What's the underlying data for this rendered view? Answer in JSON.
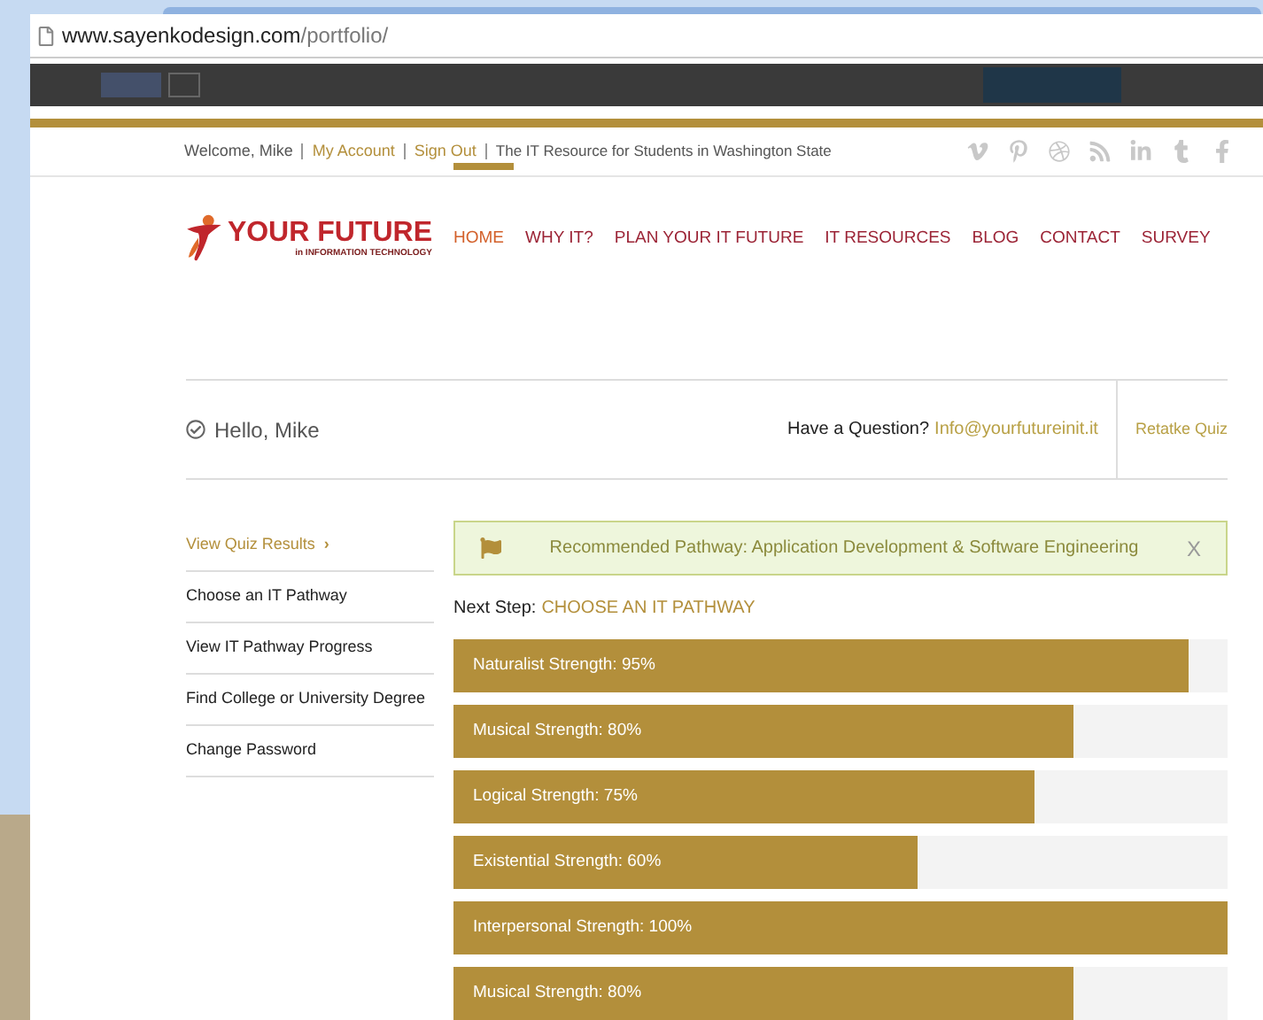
{
  "browser": {
    "url_host": "www.sayenkodesign.com",
    "url_path": "/portfolio/"
  },
  "top_bar": {
    "welcome": "Welcome, Mike",
    "links": [
      {
        "label": "My Account"
      },
      {
        "label": "Sign Out"
      }
    ],
    "tagline": "The IT Resource for Students in Washington State"
  },
  "logo": {
    "title": "YOUR FUTURE",
    "subtitle": "in INFORMATION TECHNOLOGY"
  },
  "nav": [
    {
      "label": "HOME",
      "selected": true
    },
    {
      "label": "WHY IT?",
      "selected": false
    },
    {
      "label": "PLAN YOUR IT FUTURE",
      "selected": false
    },
    {
      "label": "IT RESOURCES",
      "selected": false
    },
    {
      "label": "BLOG",
      "selected": false
    },
    {
      "label": "CONTACT",
      "selected": false
    },
    {
      "label": "SURVEY",
      "selected": false
    }
  ],
  "greeting": "Hello, Mike",
  "question": {
    "label": "Have a Question?",
    "email": "Info@yourfutureinit.it"
  },
  "retake": "Retatke Quiz",
  "sidebar": [
    {
      "label": "View Quiz Results",
      "selected": true,
      "chevron": "›"
    },
    {
      "label": "Choose an IT Pathway",
      "selected": false
    },
    {
      "label": "View IT Pathway Progress",
      "selected": false
    },
    {
      "label": "Find College or University Degree",
      "selected": false
    },
    {
      "label": "Change Password",
      "selected": false
    }
  ],
  "alert": {
    "text": "Recommended Pathway: Application Development & Software Engineering",
    "close": "X"
  },
  "next_step": {
    "label": "Next Step:",
    "value": "CHOOSE AN IT PATHWAY"
  },
  "strengths": [
    {
      "label": "Naturalist Strength: 95%",
      "level": 0.95
    },
    {
      "label": "Musical Strength: 80%",
      "level": 0.8
    },
    {
      "label": "Logical Strength: 75%",
      "level": 0.75
    },
    {
      "label": "Existential Strength: 60%",
      "level": 0.6
    },
    {
      "label": "Interpersonal Strength: 100%",
      "level": 1
    },
    {
      "label": "Musical Strength: 80%",
      "level": 0.8
    }
  ]
}
